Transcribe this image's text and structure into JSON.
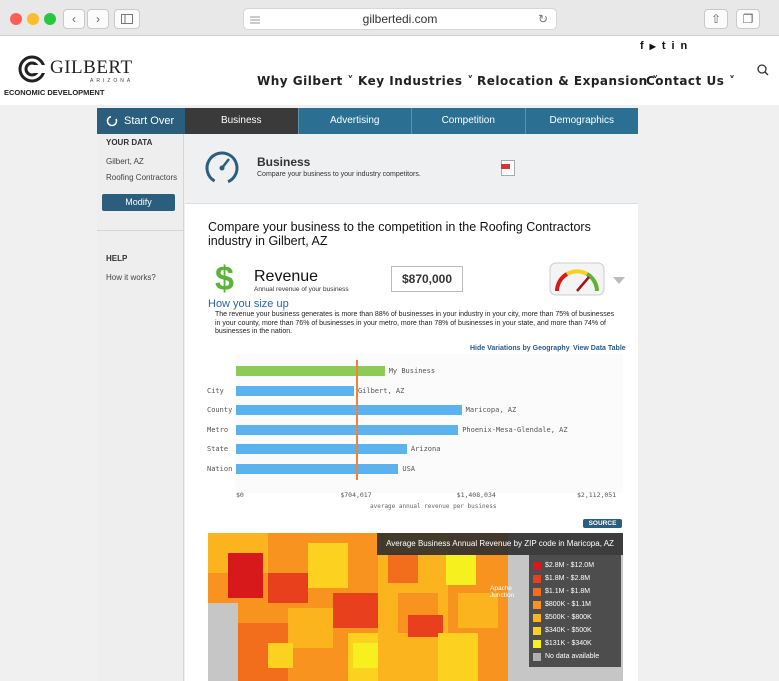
{
  "browser": {
    "url": "gilbertedi.com"
  },
  "site": {
    "logo_name": "GILBERT",
    "logo_sub": "ARIZONA",
    "logo_tag": "ECONOMIC DEVELOPMENT",
    "social": [
      "f",
      "▶",
      "t",
      "in"
    ],
    "nav": [
      "Why Gilbert ˅",
      "Key Industries ˅",
      "Relocation & Expansion ˅",
      "Contact Us ˅"
    ]
  },
  "sidebar": {
    "start_over": "Start Over",
    "your_data_heading": "YOUR DATA",
    "location": "Gilbert, AZ",
    "industry": "Roofing Contractors",
    "modify": "Modify",
    "help_heading": "HELP",
    "how_it_works": "How it works?"
  },
  "tabs": [
    {
      "label": "Business",
      "active": true
    },
    {
      "label": "Advertising",
      "active": false
    },
    {
      "label": "Competition",
      "active": false
    },
    {
      "label": "Demographics",
      "active": false
    }
  ],
  "business": {
    "title": "Business",
    "subtitle": "Compare your business to your industry competitors.",
    "compare_heading": "Compare your business to the competition in the Roofing Contractors industry in Gilbert, AZ",
    "revenue_title": "Revenue",
    "revenue_sub": "Annual revenue of your business",
    "revenue_value": "$870,000",
    "size_heading": "How you size up",
    "size_text": "The revenue your business generates is more than 88% of businesses in your industry in your city, more than 75% of businesses in your county, more than 76% of businesses in your metro, more than 78% of businesses in your state, and more than 74% of businesses in the nation.",
    "hide_variations": "Hide Variations by Geography",
    "view_table": "View Data Table",
    "source": "SOURCE"
  },
  "chart_data": {
    "type": "bar",
    "orientation": "horizontal",
    "xlabel": "average annual revenue per business",
    "x_ticks": [
      "$0",
      "$704,017",
      "$1,408,034",
      "$2,112,051"
    ],
    "xlim": [
      0,
      2112051
    ],
    "reference_line": 704017,
    "bars": [
      {
        "category": "",
        "label": "My Business",
        "value": 870000
      },
      {
        "category": "City",
        "label": "Gilbert, AZ",
        "value": 690000
      },
      {
        "category": "County",
        "label": "Maricopa, AZ",
        "value": 1320000
      },
      {
        "category": "Metro",
        "label": "Phoenix-Mesa-Glendale, AZ",
        "value": 1300000
      },
      {
        "category": "State",
        "label": "Arizona",
        "value": 1000000
      },
      {
        "category": "Nation",
        "label": "USA",
        "value": 950000
      }
    ]
  },
  "map": {
    "title": "Average Business Annual Revenue by ZIP code in Maricopa, AZ",
    "place_label": "Apache Junction",
    "legend": [
      {
        "label": "$2.8M - $12.0M",
        "color": "#d7191c"
      },
      {
        "label": "$1.8M - $2.8M",
        "color": "#e8401c"
      },
      {
        "label": "$1.1M - $1.8M",
        "color": "#f26d1c"
      },
      {
        "label": "$800K - $1.1M",
        "color": "#f7931e"
      },
      {
        "label": "$500K - $800K",
        "color": "#fbb41d"
      },
      {
        "label": "$340K - $500K",
        "color": "#fdd11f"
      },
      {
        "label": "$131K - $340K",
        "color": "#f7f01f"
      },
      {
        "label": "No data available",
        "color": "#b0b0b0"
      }
    ]
  }
}
